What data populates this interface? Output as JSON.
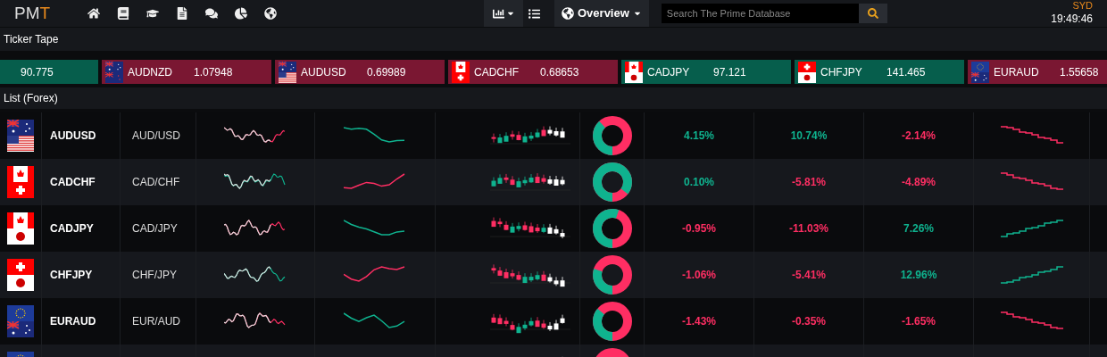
{
  "topbar": {
    "logo_main": "PM",
    "logo_accent": "T",
    "view_menu": "Overview",
    "search": {
      "placeholder": "Search The Prime Database"
    },
    "market": "SYD",
    "time": "19:49:46"
  },
  "ticker_tape": {
    "title": "Ticker Tape",
    "items": [
      {
        "price": "90.775",
        "rising": true
      },
      {
        "symbol": "AUDNZD",
        "price": "1.07948",
        "rising": false,
        "flags": [
          {
            "kind": "au"
          },
          {
            "kind": "nz"
          }
        ]
      },
      {
        "symbol": "AUDUSD",
        "price": "0.69989",
        "rising": false,
        "flags": [
          {
            "kind": "au"
          },
          {
            "kind": "us"
          }
        ]
      },
      {
        "symbol": "CADCHF",
        "price": "0.68653",
        "rising": false,
        "flags": [
          {
            "kind": "ca"
          },
          {
            "kind": "ch"
          }
        ]
      },
      {
        "symbol": "CADJPY",
        "price": "97.121",
        "rising": true,
        "flags": [
          {
            "kind": "ca"
          },
          {
            "kind": "jp"
          }
        ]
      },
      {
        "symbol": "CHFJPY",
        "price": "141.465",
        "rising": true,
        "flags": [
          {
            "kind": "ch"
          },
          {
            "kind": "jp"
          }
        ]
      },
      {
        "symbol": "EURAUD",
        "price": "1.55658",
        "rising": false,
        "flags": [
          {
            "kind": "eu"
          },
          {
            "kind": "au"
          }
        ]
      }
    ]
  },
  "list": {
    "title": "List (Forex)",
    "rows": [
      {
        "symbol": "AUDUSD",
        "pair": "AUD/USD",
        "flags": [
          {
            "kind": "au"
          },
          {
            "kind": "us"
          }
        ],
        "level": 0.38,
        "changes": [
          {
            "text": "4.15%",
            "rising": true
          },
          {
            "text": "10.74%",
            "rising": true
          },
          {
            "text": "-2.14%",
            "rising": false
          }
        ]
      },
      {
        "symbol": "CADCHF",
        "pair": "CAD/CHF",
        "flags": [
          {
            "kind": "ca"
          },
          {
            "kind": "ch"
          }
        ],
        "level": 0.85,
        "changes": [
          {
            "text": "0.10%",
            "rising": true
          },
          {
            "text": "-5.81%",
            "rising": false
          },
          {
            "text": "-4.89%",
            "rising": false
          }
        ]
      },
      {
        "symbol": "CADJPY",
        "pair": "CAD/JPY",
        "flags": [
          {
            "kind": "ca"
          },
          {
            "kind": "jp"
          }
        ],
        "level": 0.55,
        "changes": [
          {
            "text": "-0.95%",
            "rising": false
          },
          {
            "text": "-11.03%",
            "rising": false
          },
          {
            "text": "7.26%",
            "rising": true
          }
        ]
      },
      {
        "symbol": "CHFJPY",
        "pair": "CHF/JPY",
        "flags": [
          {
            "kind": "ch"
          },
          {
            "kind": "jp"
          }
        ],
        "level": 0.3,
        "changes": [
          {
            "text": "-1.06%",
            "rising": false
          },
          {
            "text": "-5.41%",
            "rising": false
          },
          {
            "text": "12.96%",
            "rising": true
          }
        ]
      },
      {
        "symbol": "EURAUD",
        "pair": "EUR/AUD",
        "flags": [
          {
            "kind": "eu"
          },
          {
            "kind": "au"
          }
        ],
        "level": 0.36,
        "changes": [
          {
            "text": "-1.43%",
            "rising": false
          },
          {
            "text": "-0.35%",
            "rising": false
          },
          {
            "text": "-1.65%",
            "rising": false
          }
        ]
      },
      {
        "flags": [
          {
            "kind": "eu"
          }
        ]
      }
    ]
  }
}
